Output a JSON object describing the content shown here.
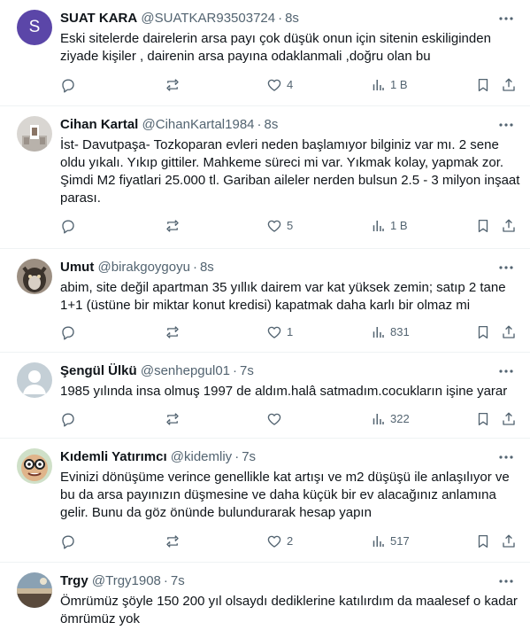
{
  "tweets": [
    {
      "name": "SUAT KARA",
      "handle": "@SUATKAR93503724",
      "time": "8s",
      "avatar_letter": "S",
      "text": "Eski sitelerde dairelerin arsa payı çok düşük  onun için sitenin eskiliginden ziyade kişiler , dairenin arsa payına odaklanmali ,doğru olan bu",
      "likes": "4",
      "views": "1 B"
    },
    {
      "name": "Cihan Kartal",
      "handle": "@CihanKartal1984",
      "time": "8s",
      "text": "İst- Davutpaşa- Tozkoparan evleri neden başlamıyor bilginiz var mı. 2 sene oldu yıkalı. Yıkıp gittiler. Mahkeme süreci mi var. Yıkmak kolay, yapmak zor. Şimdi M2 fiyatlari 25.000 tl. Gariban aileler nerden bulsun 2.5 - 3 milyon inşaat parası.",
      "likes": "5",
      "views": "1 B"
    },
    {
      "name": "Umut",
      "handle": "@birakgoygoyu",
      "time": "8s",
      "text": "abim, site değil apartman 35 yıllık dairem var  kat yüksek zemin; satıp 2 tane 1+1 (üstüne bir miktar konut kredisi) kapatmak daha karlı bir olmaz mi",
      "likes": "1",
      "views": "831"
    },
    {
      "name": "Şengül Ülkü",
      "handle": "@senhepgul01",
      "time": "7s",
      "text": "1985 yılında insa olmuş 1997 de aldım.halâ satmadım.cocukların işine yarar",
      "likes": "",
      "views": "322"
    },
    {
      "name": "Kıdemli Yatırımcı",
      "handle": "@kidemliy",
      "time": "7s",
      "text": "Evinizi dönüşüme verince genellikle kat artışı ve m2 düşüşü ile anlaşılıyor ve bu da arsa payınızın düşmesine  ve daha küçük bir ev alacağınız anlamına gelir. Bunu da  göz önünde bulundurarak hesap yapın",
      "likes": "2",
      "views": "517"
    },
    {
      "name": "Trgy",
      "handle": "@Trgy1908",
      "time": "7s",
      "text": "Ömrümüz şöyle 150 200 yıl olsaydı dediklerine katılırdım da maalesef o kadar ömrümüz yok",
      "likes": "",
      "views": ""
    }
  ],
  "colors": {
    "text": "#0f1419",
    "secondary": "#536471",
    "divider": "#eff3f4",
    "avatar_s": "#5b46a8"
  }
}
